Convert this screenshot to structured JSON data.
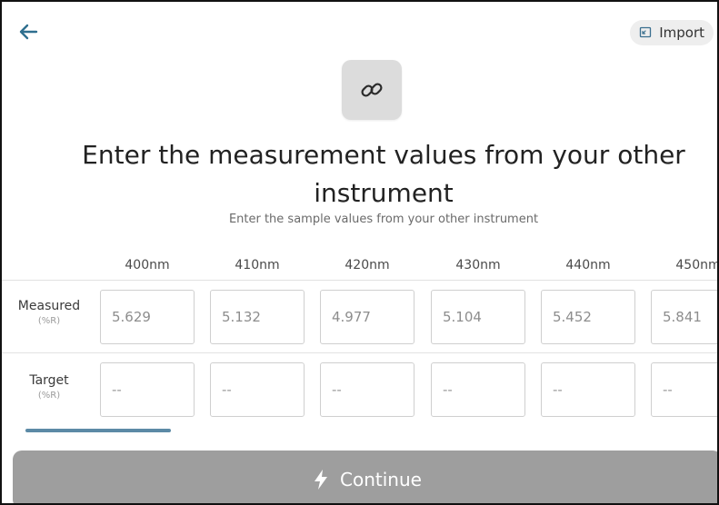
{
  "header": {
    "import_label": "Import"
  },
  "title": "Enter the measurement values from your other instrument",
  "subtitle": "Enter the sample values from your other instrument",
  "wavelengths": [
    "400nm",
    "410nm",
    "420nm",
    "430nm",
    "440nm",
    "450nm"
  ],
  "rows": [
    {
      "label": "Measured",
      "unit": "(%R)",
      "values": [
        "5.629",
        "5.132",
        "4.977",
        "5.104",
        "5.452",
        "5.841"
      ]
    },
    {
      "label": "Target",
      "unit": "(%R)",
      "placeholders": [
        "--",
        "--",
        "--",
        "--",
        "--",
        "--"
      ]
    }
  ],
  "footer": {
    "continue_label": "Continue"
  },
  "colors": {
    "accent": "#5c8aa6",
    "button_disabled": "#9e9e9e",
    "back_arrow": "#2f6f8f"
  }
}
